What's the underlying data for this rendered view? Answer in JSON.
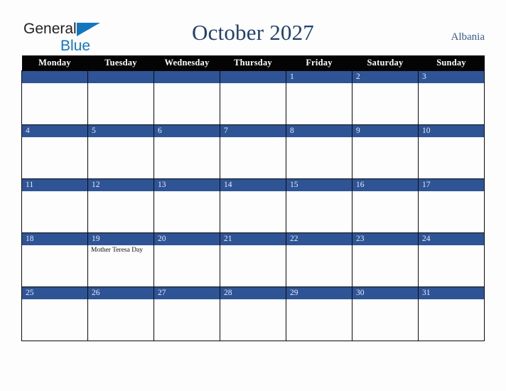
{
  "brand": {
    "line1": "General",
    "line2": "Blue",
    "triangle_color": "#1277bf",
    "text_color": "#231f20"
  },
  "header": {
    "title": "October 2027",
    "country": "Albania",
    "title_color": "#22406b",
    "country_color": "#3c5a86"
  },
  "calendar": {
    "weekday_headers": [
      "Monday",
      "Tuesday",
      "Wednesday",
      "Thursday",
      "Friday",
      "Saturday",
      "Sunday"
    ],
    "header_bg": "#040404",
    "header_text": "#ffffff",
    "daynum_bg": "#2f5496",
    "daynum_text": "#e6ecf5",
    "cell_bg": "#fdfdfe",
    "border_color": "#0a0a0a",
    "weeks": [
      [
        {
          "day": "",
          "events": []
        },
        {
          "day": "",
          "events": []
        },
        {
          "day": "",
          "events": []
        },
        {
          "day": "",
          "events": []
        },
        {
          "day": "1",
          "events": []
        },
        {
          "day": "2",
          "events": []
        },
        {
          "day": "3",
          "events": []
        }
      ],
      [
        {
          "day": "4",
          "events": []
        },
        {
          "day": "5",
          "events": []
        },
        {
          "day": "6",
          "events": []
        },
        {
          "day": "7",
          "events": []
        },
        {
          "day": "8",
          "events": []
        },
        {
          "day": "9",
          "events": []
        },
        {
          "day": "10",
          "events": []
        }
      ],
      [
        {
          "day": "11",
          "events": []
        },
        {
          "day": "12",
          "events": []
        },
        {
          "day": "13",
          "events": []
        },
        {
          "day": "14",
          "events": []
        },
        {
          "day": "15",
          "events": []
        },
        {
          "day": "16",
          "events": []
        },
        {
          "day": "17",
          "events": []
        }
      ],
      [
        {
          "day": "18",
          "events": []
        },
        {
          "day": "19",
          "events": [
            "Mother Teresa Day"
          ]
        },
        {
          "day": "20",
          "events": []
        },
        {
          "day": "21",
          "events": []
        },
        {
          "day": "22",
          "events": []
        },
        {
          "day": "23",
          "events": []
        },
        {
          "day": "24",
          "events": []
        }
      ],
      [
        {
          "day": "25",
          "events": []
        },
        {
          "day": "26",
          "events": []
        },
        {
          "day": "27",
          "events": []
        },
        {
          "day": "28",
          "events": []
        },
        {
          "day": "29",
          "events": []
        },
        {
          "day": "30",
          "events": []
        },
        {
          "day": "31",
          "events": []
        }
      ]
    ]
  }
}
